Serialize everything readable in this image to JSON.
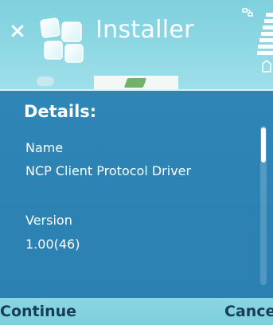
{
  "app": {
    "title": "Installer"
  },
  "icons": {
    "close": "close-icon",
    "app": "installer-icon",
    "status": "status-icon",
    "signal": "signal-strength-icon"
  },
  "dialog": {
    "title": "Details:",
    "fields": [
      {
        "label": "Name",
        "value": "NCP Client Protocol Driver"
      },
      {
        "label": "Version",
        "value": "1.00(46)"
      }
    ]
  },
  "softkeys": {
    "left": "Continue",
    "right": "Cancel"
  },
  "colors": {
    "titlebar": "#8ad6e3",
    "dialog_bg": "#2e86b6",
    "softkey_bg": "#7ccfdd",
    "softkey_text": "#173d57",
    "text": "#ffffff"
  }
}
